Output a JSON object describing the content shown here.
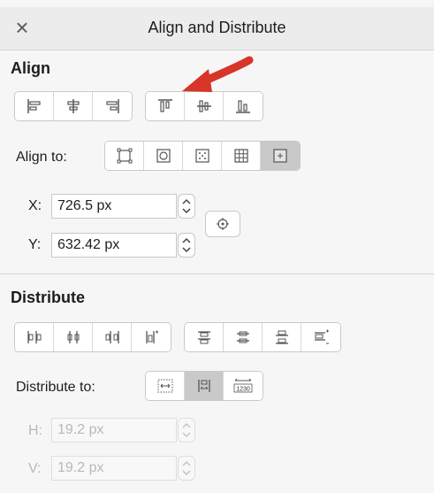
{
  "window": {
    "title": "Align and Distribute",
    "close_icon": "close-icon"
  },
  "align": {
    "section_title": "Align",
    "align_to_label": "Align to:",
    "x_label": "X:",
    "x_value": "726.5 px",
    "y_label": "Y:",
    "y_value": "632.42 px",
    "horizontal_buttons": [
      "align-left-icon",
      "align-center-horizontal-icon",
      "align-right-icon"
    ],
    "vertical_buttons": [
      "align-top-icon",
      "align-center-vertical-icon",
      "align-bottom-icon"
    ],
    "align_to_buttons": [
      "selection-bounds-icon",
      "key-object-icon",
      "spread-icon",
      "grid-icon",
      "page-icon"
    ],
    "align_to_selected": "page-icon"
  },
  "distribute": {
    "section_title": "Distribute",
    "distribute_to_label": "Distribute to:",
    "h_label": "H:",
    "h_value": "19.2 px",
    "v_label": "V:",
    "v_value": "19.2 px",
    "horizontal_buttons": [
      "distribute-left-icon",
      "distribute-center-icon",
      "distribute-right-icon",
      "distribute-spacing-horizontal-icon"
    ],
    "vertical_buttons": [
      "distribute-top-icon",
      "distribute-middle-icon",
      "distribute-bottom-icon",
      "distribute-spacing-vertical-icon"
    ],
    "distribute_to_buttons": [
      "distribute-to-selection-icon",
      "distribute-to-spacing-icon",
      "distribute-to-values-icon"
    ],
    "distribute_to_selected": "distribute-to-spacing-icon",
    "values_icon_text": "1230"
  },
  "colors": {
    "annotation_arrow": "#d8352a",
    "selected_button": "#c9c9c9"
  }
}
